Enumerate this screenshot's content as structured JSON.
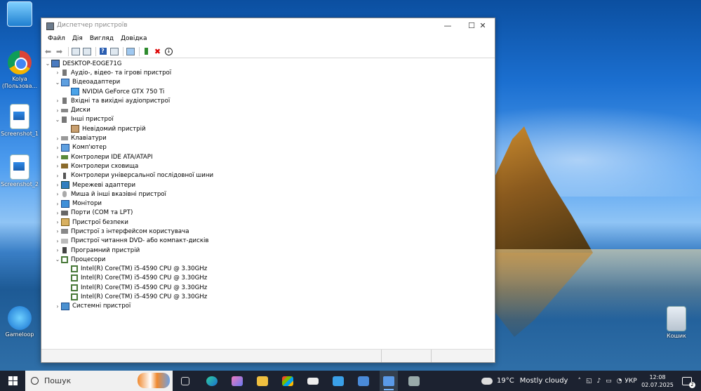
{
  "desktop": {
    "icons": [
      {
        "label": "",
        "kind": "this-pc"
      },
      {
        "label": "Kolya (Пользова...",
        "kind": "chrome"
      },
      {
        "label": "Screenshot_1",
        "kind": "image-file"
      },
      {
        "label": "Screenshot_2",
        "kind": "image-file"
      },
      {
        "label": "Gameloop",
        "kind": "gameloop"
      },
      {
        "label": "Кошик",
        "kind": "recycle-bin"
      }
    ]
  },
  "window": {
    "title": "Диспетчер пристроїв",
    "controls": {
      "minimize": "—",
      "maximize": "☐",
      "close": "✕"
    },
    "menu": [
      "Файл",
      "Дія",
      "Вигляд",
      "Довідка"
    ],
    "toolbar_icons": [
      "back-icon",
      "forward-icon",
      "properties-icon",
      "update-icon",
      "help-icon",
      "view-icon",
      "monitor-icon",
      "add-driver-icon",
      "uninstall-icon",
      "download-icon"
    ],
    "tree": {
      "root": "DESKTOP-EOGE71G",
      "nodes": [
        {
          "label": "Аудіо-, відео- та ігрові пристрої",
          "expanded": false,
          "icon": "speaker-icon",
          "children": []
        },
        {
          "label": "Відеоадаптери",
          "expanded": true,
          "icon": "display-adapter-icon",
          "children": [
            "NVIDIA GeForce GTX 750 Ti"
          ]
        },
        {
          "label": "Вхідні та вихідні аудіопристрої",
          "expanded": false,
          "icon": "audio-io-icon",
          "children": []
        },
        {
          "label": "Диски",
          "expanded": false,
          "icon": "disk-icon",
          "children": []
        },
        {
          "label": "Інші пристрої",
          "expanded": true,
          "icon": "other-devices-icon",
          "children": [
            "Невідомий пристрій"
          ]
        },
        {
          "label": "Клавіатури",
          "expanded": false,
          "icon": "keyboard-icon",
          "children": []
        },
        {
          "label": "Комп'ютер",
          "expanded": false,
          "icon": "computer-icon",
          "children": []
        },
        {
          "label": "Контролери IDE ATA/ATAPI",
          "expanded": false,
          "icon": "ide-icon",
          "children": []
        },
        {
          "label": "Контролери сховища",
          "expanded": false,
          "icon": "storage-icon",
          "children": []
        },
        {
          "label": "Контролери універсальної послідовної шини",
          "expanded": false,
          "icon": "usb-icon",
          "children": []
        },
        {
          "label": "Мережеві адаптери",
          "expanded": false,
          "icon": "network-icon",
          "children": []
        },
        {
          "label": "Миша й інші вказівні пристрої",
          "expanded": false,
          "icon": "mouse-icon",
          "children": []
        },
        {
          "label": "Монітори",
          "expanded": false,
          "icon": "monitor-icon",
          "children": []
        },
        {
          "label": "Порти (COM та LPT)",
          "expanded": false,
          "icon": "port-icon",
          "children": []
        },
        {
          "label": "Пристрої безпеки",
          "expanded": false,
          "icon": "security-icon",
          "children": []
        },
        {
          "label": "Пристрої з інтерфейсом користувача",
          "expanded": false,
          "icon": "hid-icon",
          "children": []
        },
        {
          "label": "Пристрої читання DVD- або компакт-дисків",
          "expanded": false,
          "icon": "dvd-icon",
          "children": []
        },
        {
          "label": "Програмний пристрій",
          "expanded": false,
          "icon": "software-device-icon",
          "children": []
        },
        {
          "label": "Процесори",
          "expanded": true,
          "icon": "processor-icon",
          "children": [
            "Intel(R) Core(TM) i5-4590 CPU @ 3.30GHz",
            "Intel(R) Core(TM) i5-4590 CPU @ 3.30GHz",
            "Intel(R) Core(TM) i5-4590 CPU @ 3.30GHz",
            "Intel(R) Core(TM) i5-4590 CPU @ 3.30GHz"
          ]
        },
        {
          "label": "Системні пристрої",
          "expanded": false,
          "icon": "system-devices-icon",
          "children": []
        }
      ]
    }
  },
  "taskbar": {
    "search_label": "Пошук",
    "weather": {
      "temp": "19°C",
      "condition": "Mostly cloudy"
    },
    "tray_icons": [
      "chevron-up-icon",
      "network-icon",
      "volume-icon",
      "battery-icon",
      "wifi-icon"
    ],
    "language": "УКР",
    "time": "12:08",
    "date": "02.07.2025",
    "notifications": "2"
  },
  "colors": {
    "taskbar": "#1c2230",
    "accent": "#7ab8ff",
    "title_text": "#8a8a8a"
  }
}
